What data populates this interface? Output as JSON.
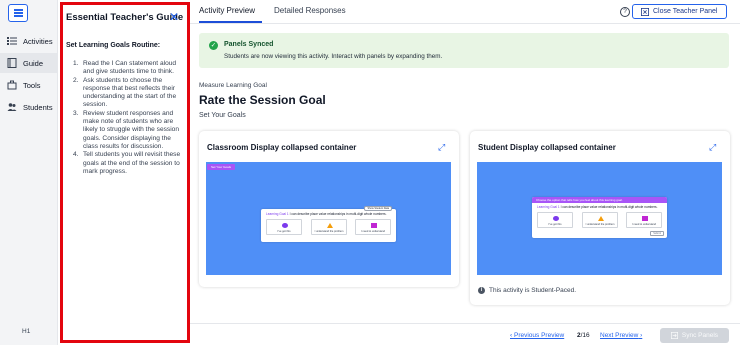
{
  "rail": {
    "items": [
      {
        "label": "Activities",
        "icon": "list-icon"
      },
      {
        "label": "Guide",
        "icon": "book-icon"
      },
      {
        "label": "Tools",
        "icon": "toolbox-icon"
      },
      {
        "label": "Students",
        "icon": "people-icon"
      }
    ],
    "active_index": 1,
    "footer_text": "H1"
  },
  "guide": {
    "title": "Essential Teacher's Guide",
    "subtitle": "Set Learning Goals Routine:",
    "steps": [
      "Read the I Can statement aloud and give students time to think.",
      "Ask students to choose the response that best reflects their understanding at the start of the session.",
      "Review student responses and make note of students who are likely to struggle with the session goals. Consider displaying the class results for discussion.",
      "Tell students you will revisit these goals at the end of the session to mark progress."
    ]
  },
  "tabs": [
    {
      "label": "Activity Preview"
    },
    {
      "label": "Detailed Responses"
    }
  ],
  "header": {
    "help_symbol": "?",
    "close_panel_label": "Close Teacher Panel"
  },
  "banner": {
    "title": "Panels Synced",
    "text": "Students are now viewing this activity. Interact with panels by expanding them."
  },
  "main": {
    "eyebrow": "Measure Learning Goal",
    "title": "Rate the Session Goal",
    "section_label": "Set Your Goals"
  },
  "cards": {
    "classroom": {
      "title": "Classroom Display collapsed container",
      "chip": "Set Your Goals",
      "question_prefix": "Learning Goal 1",
      "question_rest": " I can describe place value relationships in multi-digit whole numbers.",
      "pill": "Show Student Data",
      "options": [
        "I've got this",
        "I understand the problem",
        "I need to understand"
      ]
    },
    "student": {
      "title": "Student Display collapsed container",
      "banner": "Choose the option that tells how you feel about this learning goal.",
      "question_prefix": "Learning Goal 1",
      "question_rest": " I can describe place value relationships in multi-digit whole numbers.",
      "options": [
        "I've got this",
        "I understand the problem",
        "I need to understand"
      ],
      "button": "Submit",
      "paced_text": "This activity is Student-Paced."
    }
  },
  "footer": {
    "previous_label": "Previous Preview",
    "current": "2",
    "total": "/16",
    "next_label": "Next Preview",
    "sync_label": "Sync Panels"
  },
  "colors": {
    "accent": "#2563eb",
    "highlight_border": "#e3050e",
    "preview_background": "#4f8ff7",
    "banner_background": "#e8f5e4",
    "chip_purple": "#a855f7"
  }
}
